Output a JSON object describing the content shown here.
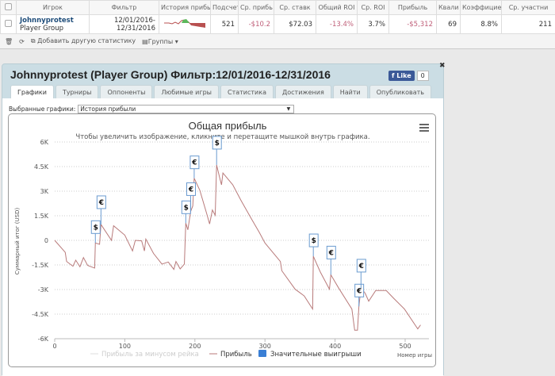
{
  "table": {
    "headers": [
      "Игрок",
      "Фильтр",
      "История прибы",
      "Подсчет",
      "Ср. прибь",
      "Ср. ставк",
      "Общий ROI",
      "Ср. ROI",
      "Прибыль",
      "Квали",
      "Коэффицие",
      "Ср. участни"
    ],
    "row": {
      "player": "Johnnyprotest",
      "group": "Player Group",
      "filter_from": "12/01/2016-",
      "filter_to": "12/31/2016",
      "count": "521",
      "avg_profit": "-$10.2",
      "avg_stake": "$72.03",
      "total_roi": "-13.4%",
      "avg_roi": "3.7%",
      "profit": "-$5,312",
      "itm": "69",
      "ratio": "8.8%",
      "avg_field": "211"
    }
  },
  "toolbar": {
    "add_stat": "Добавить другую статистику",
    "groups": "Группы"
  },
  "dialog": {
    "title": "Johnnyprotest (Player Group) Фильтр:12/01/2016-12/31/2016",
    "like": "Like",
    "like_count": "0",
    "tabs": [
      "Графики",
      "Турниры",
      "Оппоненты",
      "Любимые игры",
      "Статистика",
      "Достижения",
      "Найти",
      "Опубликовать"
    ],
    "selected_label": "Выбранные графики:",
    "selected_value": "История прибыли"
  },
  "chart_data": {
    "type": "line",
    "title": "Общая прибыль",
    "subtitle": "Чтобы увеличить изображение, кликните и перетащите мышкой внутрь графика.",
    "xlabel": "Номер игры",
    "ylabel": "Суммарный итог (USD)",
    "xlim": [
      0,
      525
    ],
    "ylim": [
      -6000,
      6000
    ],
    "xticks": [
      "0",
      "100",
      "200",
      "300",
      "400",
      "500"
    ],
    "yticks": [
      "6K",
      "4.5K",
      "3K",
      "1.5K",
      "0",
      "-1.5K",
      "-3K",
      "-4.5K",
      "-6K"
    ],
    "grid": true,
    "legend": "bottom",
    "legend_items": [
      "Прибыль за минусом рейка",
      "Прибыль",
      "Значительные выигрыши"
    ],
    "colors": {
      "profit": "#b87a7a",
      "rake": "#dddddd",
      "big_wins": "#3a7fd5"
    },
    "series": [
      {
        "name": "Прибыль",
        "points": [
          [
            0,
            0
          ],
          [
            15,
            -730
          ],
          [
            17,
            -1290
          ],
          [
            26,
            -1580
          ],
          [
            30,
            -1210
          ],
          [
            36,
            -1610
          ],
          [
            41,
            -1050
          ],
          [
            47,
            -1530
          ],
          [
            57,
            -1690
          ],
          [
            58,
            -160
          ],
          [
            64,
            -240
          ],
          [
            66,
            970
          ],
          [
            81,
            0
          ],
          [
            84,
            890
          ],
          [
            100,
            320
          ],
          [
            111,
            -645
          ],
          [
            115,
            0
          ],
          [
            124,
            -30
          ],
          [
            128,
            -645
          ],
          [
            130,
            80
          ],
          [
            141,
            -800
          ],
          [
            153,
            -1450
          ],
          [
            162,
            -1320
          ],
          [
            170,
            -1770
          ],
          [
            173,
            -1290
          ],
          [
            179,
            -1740
          ],
          [
            185,
            -1450
          ],
          [
            187,
            1050
          ],
          [
            190,
            645
          ],
          [
            194,
            1770
          ],
          [
            197,
            2100
          ],
          [
            199,
            3790
          ],
          [
            207,
            3060
          ],
          [
            217,
            1610
          ],
          [
            221,
            1000
          ],
          [
            225,
            1850
          ],
          [
            229,
            1530
          ],
          [
            231,
            4600
          ],
          [
            236,
            3710
          ],
          [
            238,
            3390
          ],
          [
            240,
            4110
          ],
          [
            254,
            3390
          ],
          [
            266,
            2420
          ],
          [
            281,
            1290
          ],
          [
            292,
            480
          ],
          [
            300,
            -160
          ],
          [
            322,
            -1290
          ],
          [
            324,
            -1850
          ],
          [
            343,
            -2980
          ],
          [
            356,
            -3390
          ],
          [
            368,
            -4190
          ],
          [
            369,
            -970
          ],
          [
            379,
            -1935
          ],
          [
            392,
            -2980
          ],
          [
            394,
            -2100
          ],
          [
            405,
            -2900
          ],
          [
            424,
            -4190
          ],
          [
            428,
            -5480
          ],
          [
            432,
            -5480
          ],
          [
            434,
            -4030
          ],
          [
            437,
            -2900
          ],
          [
            443,
            -3230
          ],
          [
            448,
            -3710
          ],
          [
            458,
            -3060
          ],
          [
            473,
            -3060
          ],
          [
            484,
            -3550
          ],
          [
            499,
            -4190
          ],
          [
            518,
            -5400
          ],
          [
            522,
            -5160
          ]
        ]
      }
    ],
    "big_wins": [
      {
        "game": 58,
        "symbol": "$"
      },
      {
        "game": 66,
        "symbol": "€"
      },
      {
        "game": 187,
        "symbol": "$"
      },
      {
        "game": 194,
        "symbol": "€"
      },
      {
        "game": 199,
        "symbol": "€"
      },
      {
        "game": 231,
        "symbol": "$"
      },
      {
        "game": 369,
        "symbol": "$"
      },
      {
        "game": 394,
        "symbol": "€"
      },
      {
        "game": 434,
        "symbol": "€"
      },
      {
        "game": 437,
        "symbol": "€"
      }
    ]
  }
}
